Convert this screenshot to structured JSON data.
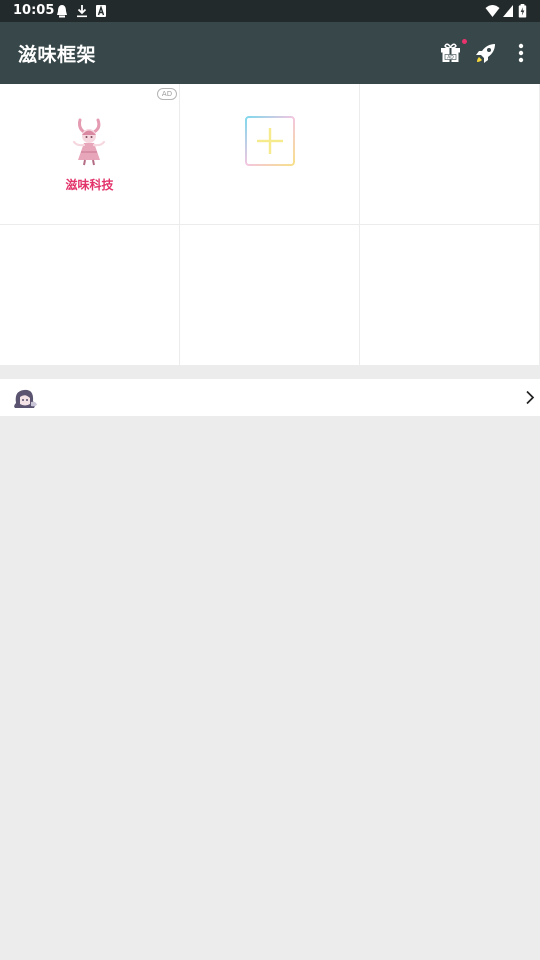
{
  "status_bar": {
    "time": "10:05",
    "left_icons": [
      "notification-bell-icon",
      "download-icon",
      "font-a-icon"
    ],
    "right_icons": [
      "wifi-icon",
      "cell-signal-icon",
      "battery-charging-icon"
    ]
  },
  "app_bar": {
    "title": "滋味框架",
    "actions": [
      "gift-ad-icon",
      "rocket-icon",
      "more-vert-icon"
    ],
    "badge_color": "#e8336d"
  },
  "grid": {
    "apps": [
      {
        "label": "滋味科技",
        "icon": "pink-character-icon",
        "ad_badge": "AD"
      },
      {
        "label": "",
        "icon": "add-plus-icon"
      },
      {
        "label": "",
        "icon": ""
      },
      {
        "label": "",
        "icon": ""
      },
      {
        "label": "",
        "icon": ""
      },
      {
        "label": "",
        "icon": ""
      }
    ]
  },
  "list_row": {
    "icon": "anime-avatar-icon",
    "chevron": "chevron-right-icon"
  },
  "colors": {
    "status_bar": "#232a2b",
    "app_bar": "#37474a",
    "accent_label": "#e2336a",
    "background": "#ececec"
  }
}
